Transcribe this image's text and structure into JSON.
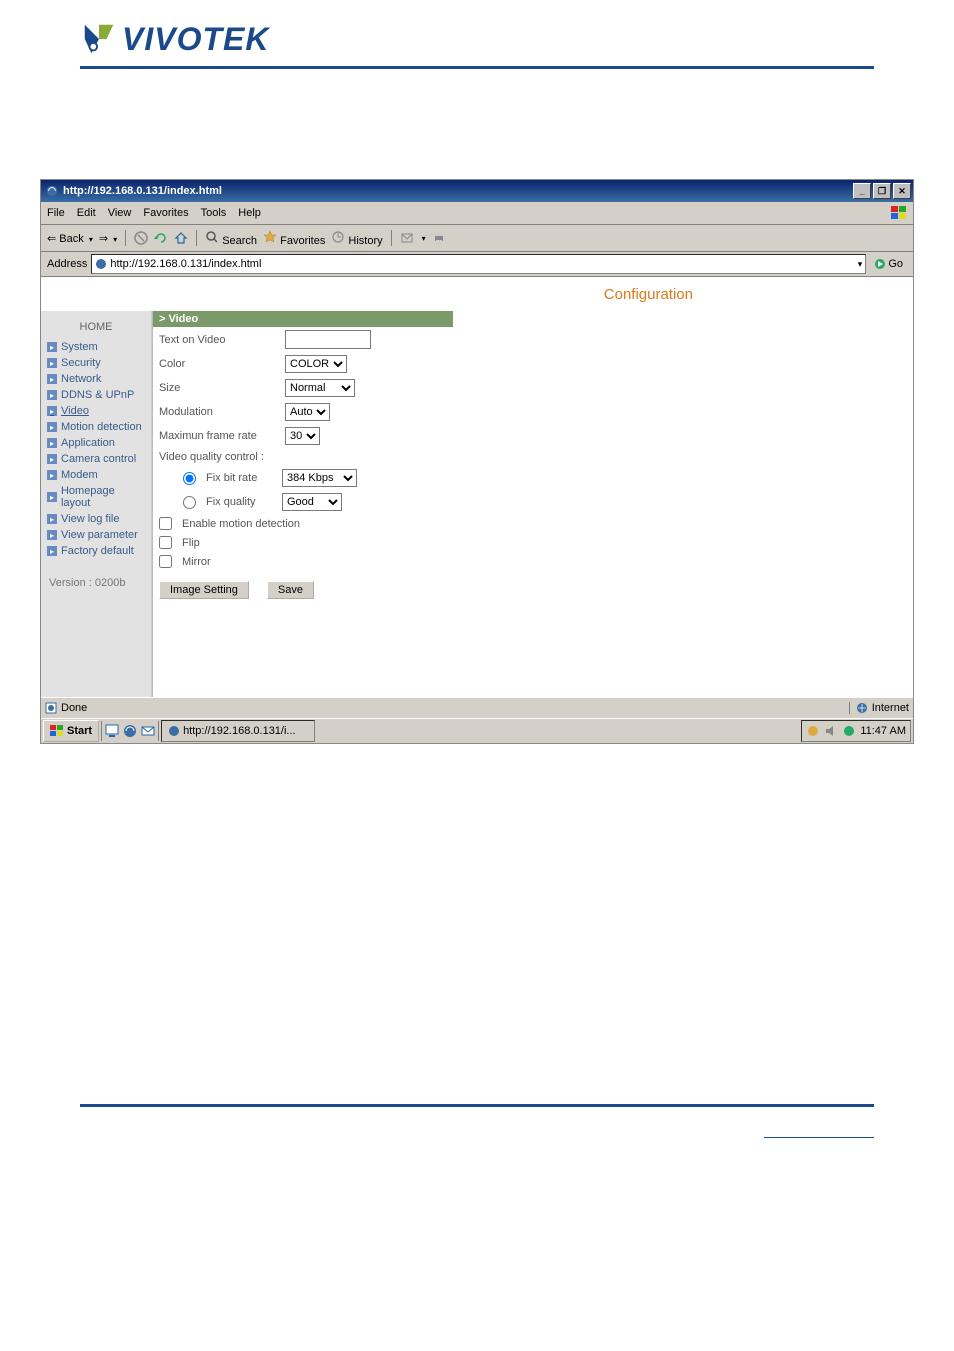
{
  "logo_text": "VIVOTEK",
  "window": {
    "title": "http://192.168.0.131/index.html",
    "minimize": "_",
    "maximize": "❐",
    "close": "✕"
  },
  "menu": [
    "File",
    "Edit",
    "View",
    "Favorites",
    "Tools",
    "Help"
  ],
  "toolbar": {
    "back": "Back",
    "search": "Search",
    "favorites": "Favorites",
    "history": "History"
  },
  "addressbar": {
    "label": "Address",
    "url": "http://192.168.0.131/index.html",
    "go": "Go"
  },
  "config_title": "Configuration",
  "sidebar": {
    "home": "HOME",
    "items": [
      "System",
      "Security",
      "Network",
      "DDNS & UPnP",
      "Video",
      "Motion detection",
      "Application",
      "Camera control",
      "Modem",
      "Homepage layout",
      "View log file",
      "View parameter",
      "Factory default"
    ],
    "version": "Version : 0200b"
  },
  "form": {
    "section": "> Video",
    "text_on_video_label": "Text on Video",
    "text_on_video_value": "",
    "color_label": "Color",
    "color_value": "COLOR",
    "size_label": "Size",
    "size_value": "Normal",
    "modulation_label": "Modulation",
    "modulation_value": "Auto",
    "max_frame_label": "Maximun frame rate",
    "max_frame_value": "30",
    "vqc_label": "Video quality control :",
    "fix_bit_rate_label": "Fix bit rate",
    "fix_bit_rate_value": "384 Kbps",
    "fix_quality_label": "Fix quality",
    "fix_quality_value": "Good",
    "enable_motion_label": "Enable motion detection",
    "flip_label": "Flip",
    "mirror_label": "Mirror",
    "image_setting_btn": "Image Setting",
    "save_btn": "Save"
  },
  "statusbar": {
    "done": "Done",
    "internet": "Internet"
  },
  "taskbar": {
    "start": "Start",
    "task": "http://192.168.0.131/i...",
    "time": "11:47 AM"
  }
}
